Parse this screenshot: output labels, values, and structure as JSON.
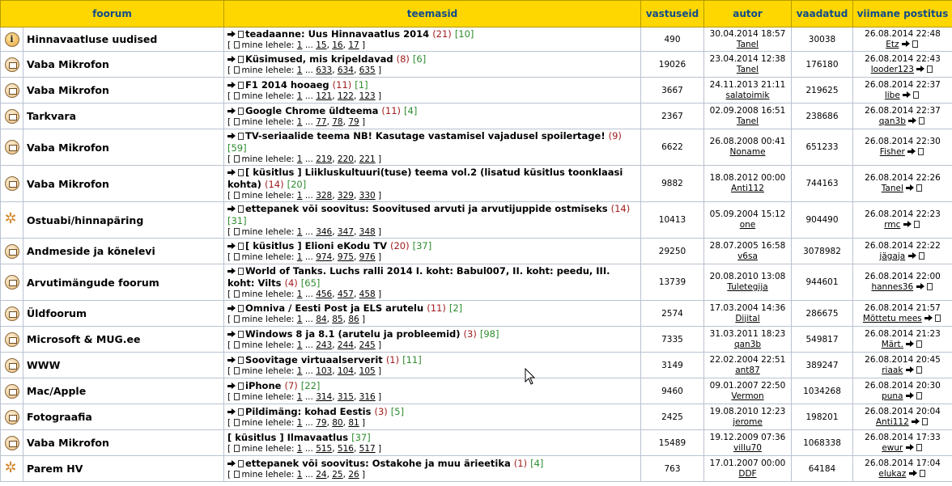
{
  "headers": {
    "forum": "foorum",
    "topics": "teemasid",
    "replies": "vastuseid",
    "author": "autor",
    "views": "vaadatud",
    "last_post": "viimane postitus"
  },
  "page_label": "mine lehele:",
  "rows": [
    {
      "icon": "info-icon",
      "forum": "Hinnavaatluse uudised",
      "title": "teadaanne: Uus Hinnavaatlus 2014",
      "red": "(21)",
      "green": "[10]",
      "pages": [
        "1",
        "15",
        "16",
        "17"
      ],
      "replies": "490",
      "created": "30.04.2014 18:57",
      "author": "Tanel",
      "views": "30038",
      "last_date": "26.08.2014 22:48",
      "last_user": "Etz"
    },
    {
      "icon": "mail-icon",
      "forum": "Vaba Mikrofon",
      "title": "Küsimused, mis kripeldavad",
      "red": "(8)",
      "green": "[6]",
      "pages": [
        "1",
        "633",
        "634",
        "635"
      ],
      "replies": "19026",
      "created": "23.04.2014 12:38",
      "author": "Tanel",
      "views": "176180",
      "last_date": "26.08.2014 22:43",
      "last_user": "looder123"
    },
    {
      "icon": "mail-icon",
      "forum": "Vaba Mikrofon",
      "title": "F1 2014 hooaeg",
      "red": "(11)",
      "green": "[1]",
      "pages": [
        "1",
        "121",
        "122",
        "123"
      ],
      "replies": "3667",
      "created": "24.11.2013 21:11",
      "author": "salatoimik",
      "views": "219625",
      "last_date": "26.08.2014 22:37",
      "last_user": "libe"
    },
    {
      "icon": "mail-icon",
      "forum": "Tarkvara",
      "title": "Google Chrome üldteema",
      "red": "(11)",
      "green": "[4]",
      "pages": [
        "1",
        "77",
        "78",
        "79"
      ],
      "replies": "2367",
      "created": "02.09.2008 16:51",
      "author": "Tanel",
      "views": "238686",
      "last_date": "26.08.2014 22:37",
      "last_user": "qan3b"
    },
    {
      "icon": "mail-icon",
      "forum": "Vaba Mikrofon",
      "title": "TV-seriaalide teema NB! Kasutage vastamisel vajadusel spoilertage!",
      "red": "(9)",
      "green": "[59]",
      "pages": [
        "1",
        "219",
        "220",
        "221"
      ],
      "replies": "6622",
      "created": "26.08.2008 00:41",
      "author": "Noname",
      "views": "651233",
      "last_date": "26.08.2014 22:30",
      "last_user": "Fisher"
    },
    {
      "icon": "mail-icon",
      "forum": "Vaba Mikrofon",
      "title": "[ küsitlus ] Liikluskultuuri(tuse) teema vol.2 (lisatud küsitlus toonklaasi kohta)",
      "red": "(14)",
      "green": "[20]",
      "pages": [
        "1",
        "328",
        "329",
        "330"
      ],
      "replies": "9882",
      "created": "18.08.2012 00:00",
      "author": "Anti112",
      "views": "744163",
      "last_date": "26.08.2014 22:26",
      "last_user": "Tanel"
    },
    {
      "icon": "star-icon",
      "forum": "Ostuabi/hinnapäring",
      "title": "ettepanek või soovitus: Soovitused arvuti ja arvutijuppide ostmiseks",
      "red": "(14)",
      "green": "[31]",
      "pages": [
        "1",
        "346",
        "347",
        "348"
      ],
      "replies": "10413",
      "created": "05.09.2004 15:12",
      "author": "one",
      "views": "904490",
      "last_date": "26.08.2014 22:23",
      "last_user": "rmc"
    },
    {
      "icon": "mail-icon",
      "forum": "Andmeside ja kõnelevi",
      "title": "[ küsitlus ] Elioni eKodu TV",
      "red": "(20)",
      "green": "[37]",
      "pages": [
        "1",
        "974",
        "975",
        "976"
      ],
      "replies": "29250",
      "created": "28.07.2005 16:58",
      "author": "v6sa",
      "views": "3078982",
      "last_date": "26.08.2014 22:22",
      "last_user": "jägaja"
    },
    {
      "icon": "mail-icon",
      "forum": "Arvutimängude foorum",
      "title": "World of Tanks. Luchs ralli 2014 I. koht: Babul007, II. koht: peedu, III. koht: Vilts",
      "red": "(4)",
      "green": "[65]",
      "pages": [
        "1",
        "456",
        "457",
        "458"
      ],
      "replies": "13739",
      "created": "20.08.2010 13:08",
      "author": "Tuletegija",
      "views": "944601",
      "last_date": "26.08.2014 22:00",
      "last_user": "hannes36"
    },
    {
      "icon": "mail-icon",
      "forum": "Üldfoorum",
      "title": "Omniva / Eesti Post ja ELS arutelu",
      "red": "(11)",
      "green": "[2]",
      "pages": [
        "1",
        "84",
        "85",
        "86"
      ],
      "replies": "2574",
      "created": "17.03.2004 14:36",
      "author": "Dijital",
      "views": "286675",
      "last_date": "26.08.2014 21:57",
      "last_user": "Mõttetu mees"
    },
    {
      "icon": "mail-icon",
      "forum": "Microsoft & MUG.ee",
      "title": "Windows 8 ja 8.1 (arutelu ja probleemid)",
      "red": "(3)",
      "green": "[98]",
      "pages": [
        "1",
        "243",
        "244",
        "245"
      ],
      "replies": "7335",
      "created": "31.03.2011 18:23",
      "author": "qan3b",
      "views": "549817",
      "last_date": "26.08.2014 21:23",
      "last_user": "Märt."
    },
    {
      "icon": "mail-icon",
      "forum": "WWW",
      "title": "Soovitage virtuaalserverit",
      "red": "(1)",
      "green": "[11]",
      "pages": [
        "1",
        "103",
        "104",
        "105"
      ],
      "replies": "3149",
      "created": "22.02.2004 22:51",
      "author": "ant87",
      "views": "389247",
      "last_date": "26.08.2014 20:45",
      "last_user": "riaak"
    },
    {
      "icon": "mail-icon",
      "forum": "Mac/Apple",
      "title": "iPhone",
      "red": "(7)",
      "green": "[22]",
      "pages": [
        "1",
        "314",
        "315",
        "316"
      ],
      "replies": "9460",
      "created": "09.01.2007 22:50",
      "author": "Vermon",
      "views": "1034268",
      "last_date": "26.08.2014 20:30",
      "last_user": "puna"
    },
    {
      "icon": "mail-icon",
      "forum": "Fotograafia",
      "title": "Pildimäng: kohad Eestis",
      "red": "(3)",
      "green": "[5]",
      "pages": [
        "1",
        "79",
        "80",
        "81"
      ],
      "replies": "2425",
      "created": "19.08.2010 12:23",
      "author": "jerome",
      "views": "198201",
      "last_date": "26.08.2014 20:04",
      "last_user": "Anti112"
    },
    {
      "icon": "mail-icon",
      "forum": "Vaba Mikrofon",
      "title": "[ küsitlus ] Ilmavaatlus",
      "red": "",
      "green": "[37]",
      "noarrow": true,
      "pages": [
        "1",
        "515",
        "516",
        "517"
      ],
      "replies": "15489",
      "created": "19.12.2009 07:36",
      "author": "villu70",
      "views": "1068338",
      "last_date": "26.08.2014 17:33",
      "last_user": "ewur"
    },
    {
      "icon": "star-icon",
      "forum": "Parem HV",
      "title": "ettepanek või soovitus: Ostakohe ja muu ärieetika",
      "red": "(1)",
      "green": "[4]",
      "pages": [
        "1",
        "24",
        "25",
        "26"
      ],
      "replies": "763",
      "created": "17.01.2007 00:00",
      "author": "DDF",
      "views": "64184",
      "last_date": "26.08.2014 17:04",
      "last_user": "elukaz"
    }
  ]
}
